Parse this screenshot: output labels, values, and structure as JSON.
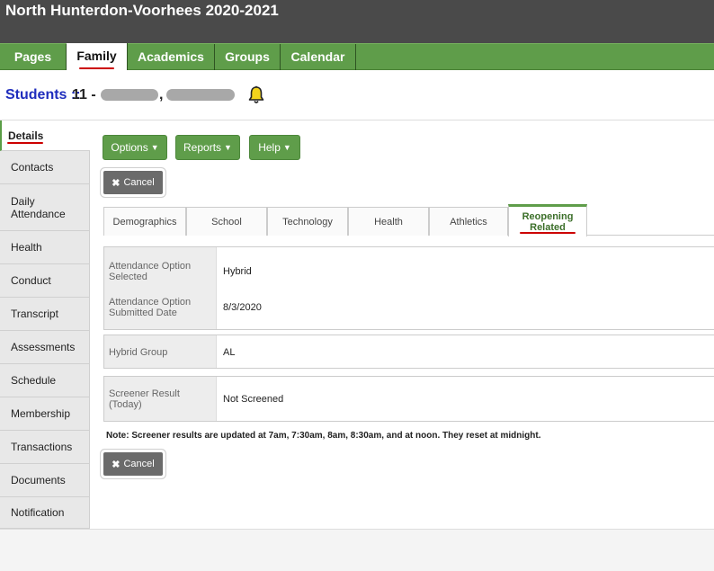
{
  "header": {
    "school_title": "North Hunterdon-Voorhees 2020-2021"
  },
  "nav": {
    "tabs": [
      {
        "label": "Pages"
      },
      {
        "label": "Family"
      },
      {
        "label": "Academics"
      },
      {
        "label": "Groups"
      },
      {
        "label": "Calendar"
      }
    ],
    "active": "Family"
  },
  "student": {
    "prefix": "Students ::",
    "id": "11 -",
    "comma": ",",
    "alert_icon": "bell-icon"
  },
  "sidebar": {
    "items": [
      {
        "label": "Details"
      },
      {
        "label": "Contacts"
      },
      {
        "label": "Daily Attendance"
      },
      {
        "label": "Health"
      },
      {
        "label": "Conduct"
      },
      {
        "label": "Transcript"
      },
      {
        "label": "Assessments"
      },
      {
        "label": "Schedule"
      },
      {
        "label": "Membership"
      },
      {
        "label": "Transactions"
      },
      {
        "label": "Documents"
      },
      {
        "label": "Notification"
      }
    ],
    "active": "Details"
  },
  "toolbar": {
    "options": "Options",
    "reports": "Reports",
    "help": "Help",
    "cancel": "Cancel"
  },
  "tabs": [
    {
      "label": "Demographics"
    },
    {
      "label": "School"
    },
    {
      "label": "Technology"
    },
    {
      "label": "Health"
    },
    {
      "label": "Athletics"
    },
    {
      "label": "Reopening Related"
    }
  ],
  "active_tab": "Reopening Related",
  "fields": {
    "attendance_option_label": "Attendance Option Selected",
    "attendance_option_value": "Hybrid",
    "attendance_date_label": "Attendance Option Submitted Date",
    "attendance_date_value": "8/3/2020",
    "hybrid_group_label": "Hybrid Group",
    "hybrid_group_value": "AL",
    "screener_label": "Screener Result (Today)",
    "screener_value": "Not Screened"
  },
  "note": "Note: Screener results are updated at 7am, 7:30am, 8am, 8:30am, and at noon. They reset at midnight.",
  "colors": {
    "nav_green": "#5f9d4a",
    "header_dark": "#4a4a4a",
    "student_blue": "#1f2dbd",
    "underline_red": "#cc0000"
  }
}
